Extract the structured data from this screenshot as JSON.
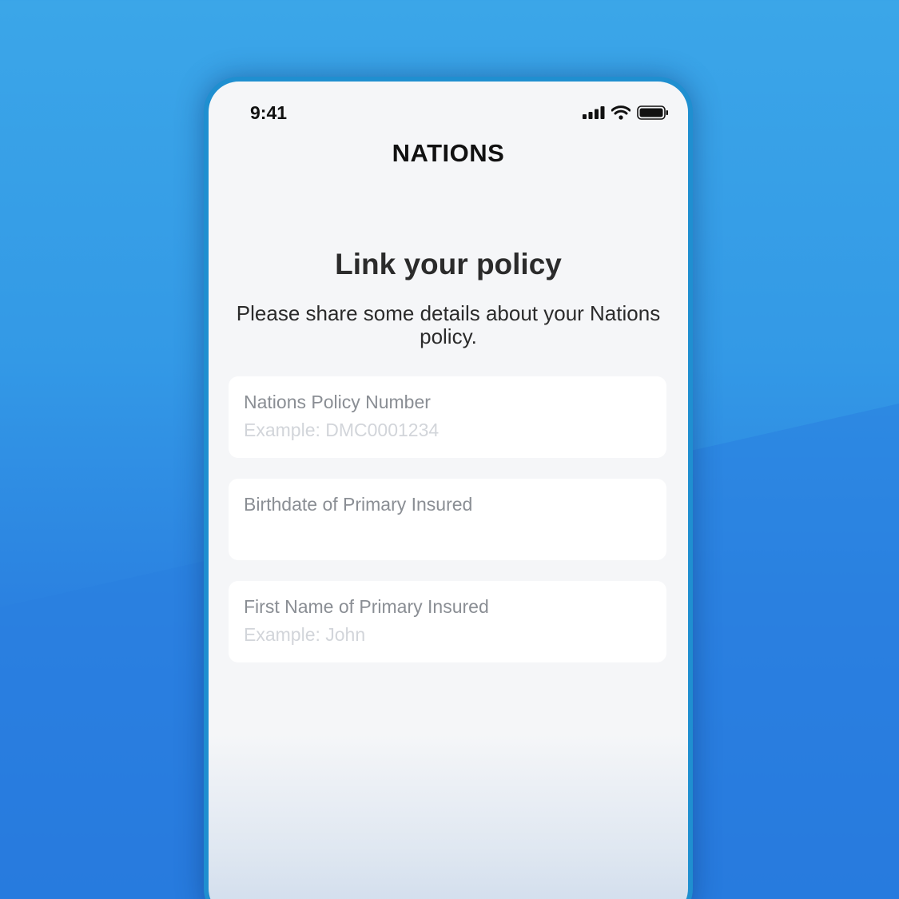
{
  "status_bar": {
    "time": "9:41",
    "icons": [
      "cellular-signal-icon",
      "wifi-icon",
      "battery-icon"
    ]
  },
  "header": {
    "brand": "NATIONS"
  },
  "main": {
    "title": "Link your policy",
    "subtitle": "Please share some details about your Nations policy."
  },
  "form": {
    "fields": [
      {
        "label": "Nations Policy Number",
        "value": "",
        "placeholder": "Example: DMC0001234"
      },
      {
        "label": "Birthdate of Primary Insured",
        "value": "",
        "placeholder": ""
      },
      {
        "label": "First Name of Primary Insured",
        "value": "",
        "placeholder": "Example: John"
      }
    ]
  },
  "colors": {
    "background_blue": "#3399e6",
    "screen_background": "#f5f6f8",
    "field_background": "#ffffff",
    "label_gray": "#8a8e94",
    "placeholder_gray": "#d2d5da",
    "text_dark": "#2b2b2b"
  }
}
